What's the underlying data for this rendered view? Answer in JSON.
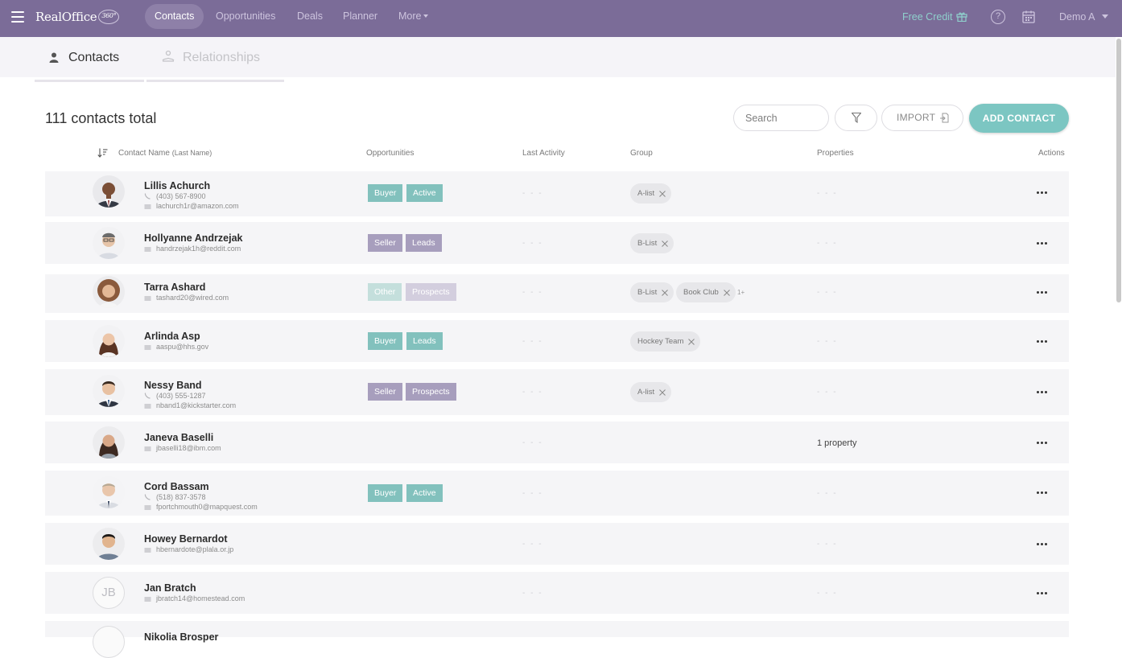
{
  "app": {
    "logo_text": "RealOffice",
    "logo_badge": "360°"
  },
  "nav": {
    "items": [
      {
        "label": "Contacts",
        "active": true
      },
      {
        "label": "Opportunities",
        "active": false
      },
      {
        "label": "Deals",
        "active": false
      },
      {
        "label": "Planner",
        "active": false
      },
      {
        "label": "More",
        "active": false
      }
    ],
    "free_credit": "Free Credit",
    "help_label": "?",
    "user": "Demo A"
  },
  "tabs": [
    {
      "label": "Contacts",
      "icon": "person-icon",
      "active": true
    },
    {
      "label": "Relationships",
      "icon": "relationships-icon",
      "active": false
    }
  ],
  "toolbar": {
    "total": "111 contacts total",
    "search_placeholder": "Search",
    "import_label": "IMPORT",
    "add_label": "ADD CONTACT"
  },
  "table": {
    "headers": {
      "name": "Contact Name",
      "name_sub": "(Last Name)",
      "opportunities": "Opportunities",
      "last_activity": "Last Activity",
      "group": "Group",
      "properties": "Properties",
      "actions": "Actions"
    },
    "rows": [
      {
        "name": "Lillis Achurch",
        "phone": "(403) 567-8900",
        "email": "lachurch1r@amazon.com",
        "opportunities": [
          "Buyer",
          "Active"
        ],
        "last_activity": "- - -",
        "groups": [
          "A-list"
        ],
        "more_groups": "",
        "properties": "- - -",
        "avatar": "man-dark-suit"
      },
      {
        "name": "Hollyanne Andrzejak",
        "phone": "",
        "email": "handrzejak1h@reddit.com",
        "opportunities": [
          "Seller",
          "Leads"
        ],
        "last_activity": "- - -",
        "groups": [
          "B-List"
        ],
        "more_groups": "",
        "properties": "- - -",
        "avatar": "man-glasses"
      },
      {
        "name": "Tarra Ashard",
        "phone": "",
        "email": "tashard20@wired.com",
        "opportunities": [
          "Other",
          "Prospects"
        ],
        "last_activity": "- - -",
        "groups": [
          "B-List",
          "Book Club"
        ],
        "more_groups": "1+",
        "properties": "- - -",
        "avatar": "woman-curly"
      },
      {
        "name": "Arlinda Asp",
        "phone": "",
        "email": "aaspu@hhs.gov",
        "opportunities": [
          "Buyer",
          "Leads"
        ],
        "last_activity": "- - -",
        "groups": [
          "Hockey Team"
        ],
        "more_groups": "",
        "properties": "- - -",
        "avatar": "woman-long-hair"
      },
      {
        "name": "Nessy Band",
        "phone": "(403) 555-1287",
        "email": "nband1@kickstarter.com",
        "opportunities": [
          "Seller",
          "Prospects"
        ],
        "last_activity": "- - -",
        "groups": [
          "A-list"
        ],
        "more_groups": "",
        "properties": "- - -",
        "avatar": "man-suit"
      },
      {
        "name": "Janeva Baselli",
        "phone": "",
        "email": "jbaselli18@ibm.com",
        "opportunities": [],
        "last_activity": "- - -",
        "groups": [],
        "more_groups": "",
        "properties": "1 property",
        "avatar": "woman-dark-hair"
      },
      {
        "name": "Cord Bassam",
        "phone": "(518) 837-3578",
        "email": "fportchmouth0@mapquest.com",
        "opportunities": [
          "Buyer",
          "Active"
        ],
        "last_activity": "- - -",
        "groups": [],
        "more_groups": "",
        "properties": "- - -",
        "avatar": "man-bald-suit"
      },
      {
        "name": "Howey Bernardot",
        "phone": "",
        "email": "hbernardote@plala.or.jp",
        "opportunities": [],
        "last_activity": "- - -",
        "groups": [],
        "more_groups": "",
        "properties": "- - -",
        "avatar": "man-sweater"
      },
      {
        "name": "Jan Bratch",
        "phone": "",
        "email": "jbratch14@homestead.com",
        "opportunities": [],
        "last_activity": "- - -",
        "groups": [],
        "more_groups": "",
        "properties": "- - -",
        "avatar": "initials",
        "initials": "JB"
      },
      {
        "name": "Nikolia Brosper",
        "phone": "",
        "email": "",
        "opportunities": [],
        "last_activity": "",
        "groups": [],
        "more_groups": "",
        "properties": "",
        "avatar": "partial"
      }
    ]
  },
  "colors": {
    "topbar": "#7b6c98",
    "accent_teal": "#7cc6c2",
    "tag_teal": "#82c1bd",
    "tag_purple": "#a79ebd"
  }
}
